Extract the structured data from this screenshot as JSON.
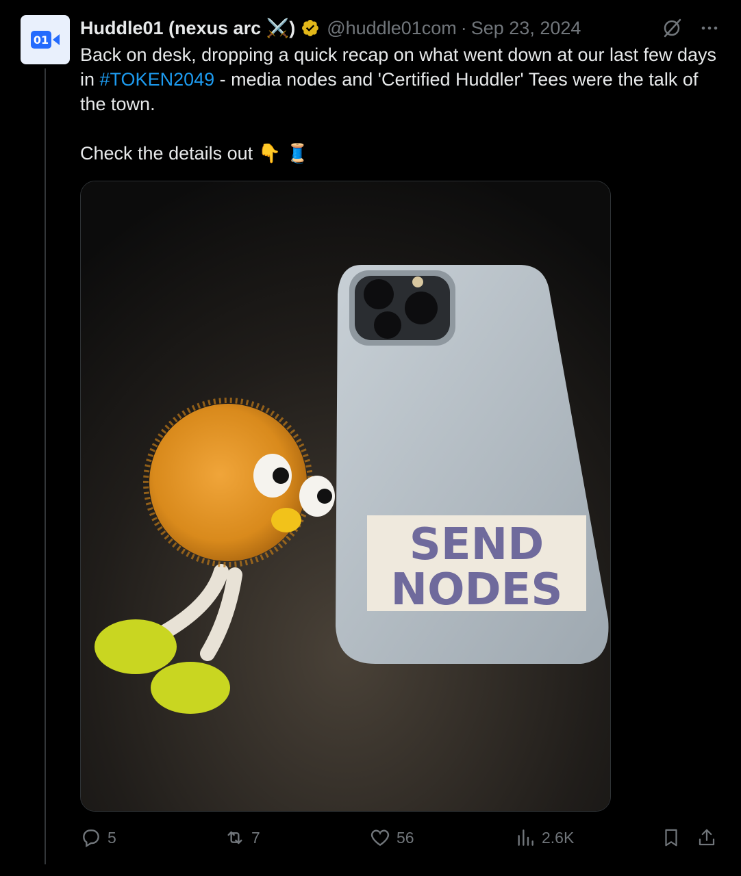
{
  "tweet": {
    "display_name": "Huddle01 (nexus arc ⚔️)",
    "handle": "@huddle01com",
    "separator": "·",
    "date": "Sep 23, 2024",
    "avatar_text": "01",
    "text_line1_before": "Back on desk, dropping a quick recap on what went down at our last few days in ",
    "hashtag": "#TOKEN2049",
    "text_line1_after": " - media nodes and 'Certified Huddler' Tees were the talk of the town.",
    "text_line2": "Check the details out 👇 🧵",
    "image_sticker_line1": "SEND",
    "image_sticker_line2": "NODES"
  },
  "actions": {
    "replies": "5",
    "reposts": "7",
    "likes": "56",
    "views": "2.6K"
  },
  "colors": {
    "background": "#000000",
    "accent": "#1d9bf0",
    "muted": "#71767b",
    "verified_badge": "#e2b719"
  },
  "icons": [
    "avatar-logo",
    "verified-badge-icon",
    "grok-icon",
    "more-icon",
    "reply-icon",
    "repost-icon",
    "like-icon",
    "views-icon",
    "bookmark-icon",
    "share-icon"
  ]
}
